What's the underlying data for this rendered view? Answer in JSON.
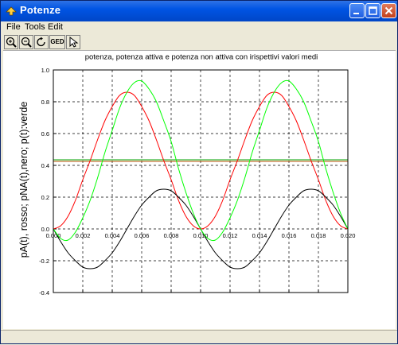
{
  "window": {
    "title": "Potenze"
  },
  "menu": {
    "file": "File",
    "tools": "Tools",
    "edit": "Edit"
  },
  "toolbar": {
    "zoom_in": "zoom-in",
    "zoom_out": "zoom-out",
    "rotate": "rotate",
    "geo_label": "GED",
    "pointer": "pointer"
  },
  "colors": {
    "pA": "#ff0000",
    "pNA": "#000000",
    "p": "#00ff00",
    "mean_p": "#00a000",
    "mean_pA": "#b05000",
    "titlebar": "#0054e3"
  },
  "chart_data": {
    "type": "line",
    "title": "potenza, potenza attiva e potenza non attiva con irispettivi valori medi",
    "ylabel": "pA(t), rosso; pNA(t),nero; p(t):verde",
    "xlabel": "",
    "xlim": [
      0.0,
      0.02
    ],
    "ylim": [
      -0.4,
      1.0
    ],
    "xticks": [
      "0.000",
      "0.002",
      "0.004",
      "0.006",
      "0.008",
      "0.010",
      "0.012",
      "0.014",
      "0.016",
      "0.018",
      "0.020"
    ],
    "yticks": [
      "-0.4",
      "-0.2",
      "0.0",
      "0.2",
      "0.4",
      "0.6",
      "0.8",
      "1.0"
    ],
    "grid": true,
    "series": [
      {
        "color": "#ff0000",
        "x": [
          0,
          0.0005,
          0.001,
          0.0015,
          0.002,
          0.0025,
          0.003,
          0.0035,
          0.004,
          0.0045,
          0.005,
          0.0055,
          0.006,
          0.0065,
          0.007,
          0.0075,
          0.008,
          0.0085,
          0.009,
          0.0095,
          0.01,
          0.0105,
          0.011,
          0.0115,
          0.012,
          0.0125,
          0.013,
          0.0135,
          0.014,
          0.0145,
          0.015,
          0.0155,
          0.016,
          0.0165,
          0.017,
          0.0175,
          0.018,
          0.0185,
          0.019,
          0.0195,
          0.02
        ],
        "y": [
          0,
          0.02,
          0.08,
          0.18,
          0.31,
          0.43,
          0.56,
          0.68,
          0.77,
          0.84,
          0.86,
          0.84,
          0.77,
          0.68,
          0.56,
          0.43,
          0.31,
          0.18,
          0.08,
          0.02,
          0,
          0.02,
          0.08,
          0.18,
          0.31,
          0.43,
          0.56,
          0.68,
          0.77,
          0.84,
          0.86,
          0.84,
          0.77,
          0.68,
          0.56,
          0.43,
          0.31,
          0.18,
          0.08,
          0.02,
          0
        ]
      },
      {
        "color": "#000000",
        "x": [
          0,
          0.0005,
          0.001,
          0.0015,
          0.002,
          0.0025,
          0.003,
          0.0035,
          0.004,
          0.0045,
          0.005,
          0.0055,
          0.006,
          0.0065,
          0.007,
          0.0075,
          0.008,
          0.0085,
          0.009,
          0.0095,
          0.01,
          0.0105,
          0.011,
          0.0115,
          0.012,
          0.0125,
          0.013,
          0.0135,
          0.014,
          0.0145,
          0.015,
          0.0155,
          0.016,
          0.0165,
          0.017,
          0.0175,
          0.018,
          0.0185,
          0.019,
          0.0195,
          0.02
        ],
        "y": [
          0,
          -0.08,
          -0.15,
          -0.2,
          -0.24,
          -0.25,
          -0.24,
          -0.2,
          -0.15,
          -0.08,
          0,
          0.08,
          0.15,
          0.2,
          0.24,
          0.25,
          0.24,
          0.2,
          0.15,
          0.08,
          0,
          -0.08,
          -0.15,
          -0.2,
          -0.24,
          -0.25,
          -0.24,
          -0.2,
          -0.15,
          -0.08,
          0,
          0.08,
          0.15,
          0.2,
          0.24,
          0.25,
          0.24,
          0.2,
          0.15,
          0.08,
          0
        ]
      },
      {
        "color": "#00ff00",
        "x": [
          0,
          0.0005,
          0.001,
          0.0015,
          0.002,
          0.0025,
          0.003,
          0.0035,
          0.004,
          0.0045,
          0.005,
          0.0055,
          0.006,
          0.0065,
          0.007,
          0.0075,
          0.008,
          0.0085,
          0.009,
          0.0095,
          0.01,
          0.0105,
          0.011,
          0.0115,
          0.012,
          0.0125,
          0.013,
          0.0135,
          0.014,
          0.0145,
          0.015,
          0.0155,
          0.016,
          0.0165,
          0.017,
          0.0175,
          0.018,
          0.0185,
          0.019,
          0.0195,
          0.02
        ],
        "y": [
          0,
          -0.06,
          -0.07,
          -0.02,
          0.07,
          0.18,
          0.32,
          0.48,
          0.62,
          0.76,
          0.86,
          0.92,
          0.93,
          0.88,
          0.8,
          0.68,
          0.55,
          0.38,
          0.23,
          0.1,
          0,
          -0.06,
          -0.07,
          -0.02,
          0.07,
          0.18,
          0.32,
          0.48,
          0.62,
          0.76,
          0.86,
          0.92,
          0.93,
          0.88,
          0.8,
          0.68,
          0.55,
          0.38,
          0.23,
          0.1,
          0
        ]
      }
    ],
    "hlines": [
      {
        "color": "#00a000",
        "y": 0.435
      },
      {
        "color": "#b05000",
        "y": 0.425
      }
    ]
  }
}
